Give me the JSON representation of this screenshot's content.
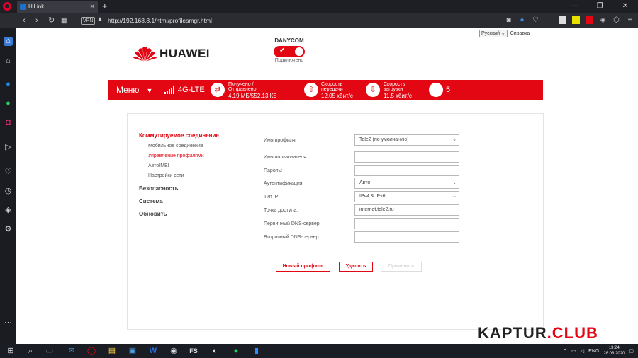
{
  "browser": {
    "tab_title": "HiLink",
    "tab_close": "✕",
    "new_tab": "+",
    "url": "http://192.168.8.1/html/profilesmgr.html",
    "vpn": "VPN",
    "window_buttons": [
      "—",
      "❐",
      "✕"
    ]
  },
  "header": {
    "language": "Русский",
    "help": "Справка",
    "brand": "HUAWEI",
    "operator": "DANYCOM",
    "connection_status": "Подключено"
  },
  "statusbar": {
    "menu": "Меню",
    "menu_arrow": "▼",
    "network": "4G-LTE",
    "traffic_label": "Получено / Отправлено",
    "traffic_value": "4.19 МБ/552.13 КБ",
    "upload_label": "Скорость передачи",
    "upload_value": "12.05 кбит/с",
    "download_label": "Скорость загрузки",
    "download_value": "11.5 кбит/с",
    "devices": "5"
  },
  "nav": {
    "section1": "Коммутируемое соединение",
    "items": [
      "Мобильное соединение",
      "Управление профилями",
      "АвтоIMEI",
      "Настройки сети"
    ],
    "section2": "Безопасность",
    "section3": "Система",
    "section4": "Обновить"
  },
  "form": {
    "profile_name_label": "Имя профиля:",
    "profile_name_value": "Tele2 (по умолчанию)",
    "username_label": "Имя пользователя:",
    "username_value": "",
    "password_label": "Пароль:",
    "password_value": "",
    "auth_label": "Аутентификация:",
    "auth_value": "Авто",
    "ip_type_label": "Тип IP:",
    "ip_type_value": "IPv4 & IPv6",
    "apn_label": "Точка доступа:",
    "apn_value": "internet.tele2.ru",
    "dns1_label": "Первичный DNS-сервер:",
    "dns1_value": "",
    "dns2_label": "Вторичный DNS-сервер:",
    "dns2_value": ""
  },
  "buttons": {
    "new_profile": "Новый профиль",
    "delete": "Удалить",
    "apply": "Применить"
  },
  "watermark": {
    "part1": "KAPTUR",
    "part2": ".CLUB"
  },
  "taskbar": {
    "lang": "ENG",
    "time": "13:24",
    "date": "28.08.2020",
    "fs": "FS"
  },
  "colors": {
    "accent": "#e30613",
    "chrome": "#2b2c32"
  }
}
